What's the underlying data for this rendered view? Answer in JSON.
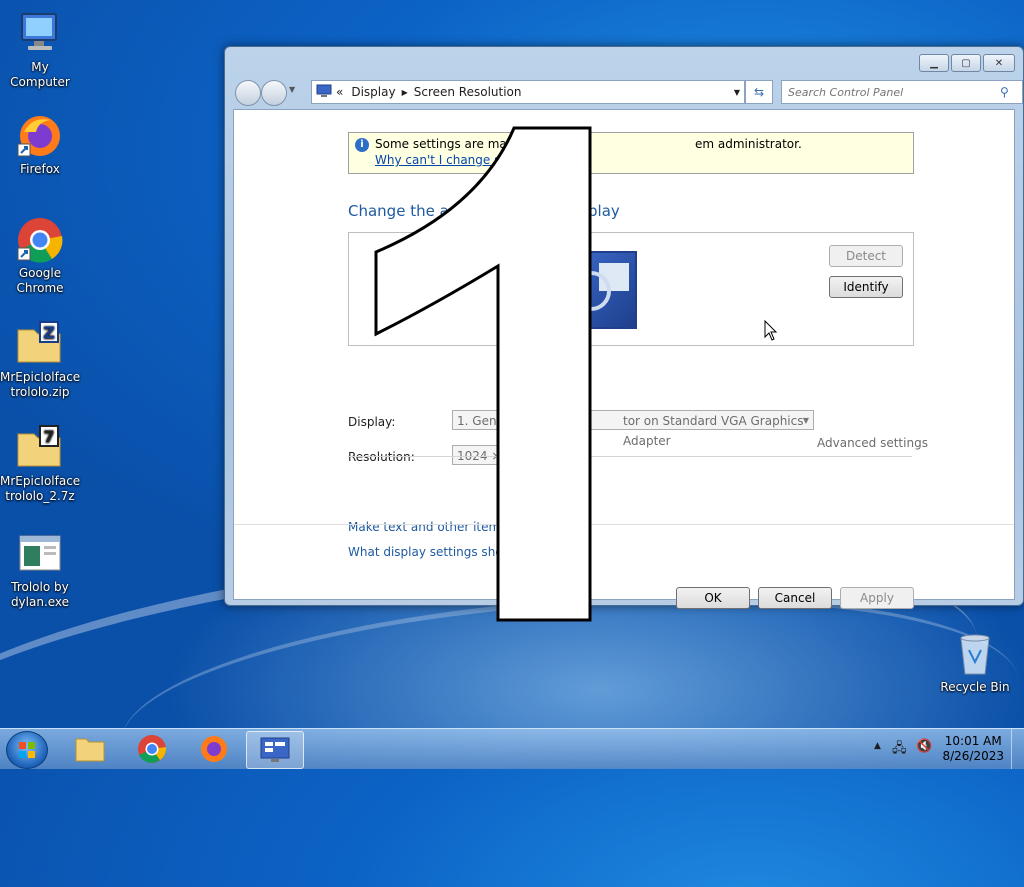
{
  "desktop": {
    "icons": [
      {
        "label": "My Computer"
      },
      {
        "label": "Firefox"
      },
      {
        "label": "Google Chrome"
      },
      {
        "label": "MrEpicIolface trololo.zip"
      },
      {
        "label": "MrEpicIolface trololo_2.7z"
      },
      {
        "label": "Trololo by dylan.exe"
      },
      {
        "label": "Recycle Bin"
      }
    ]
  },
  "window": {
    "breadcrumb": {
      "prefix": "«",
      "items": [
        "Display",
        "Screen Resolution"
      ]
    },
    "search_placeholder": "Search Control Panel",
    "info": {
      "text": "Some settings are manag",
      "text_right": "em administrator.",
      "link": "Why can't I change som"
    },
    "heading_left": "Change the ap",
    "heading_right": "play",
    "buttons": {
      "detect": "Detect",
      "identify": "Identify",
      "ok": "OK",
      "cancel": "Cancel",
      "apply": "Apply"
    },
    "display_label": "Display:",
    "display_value_left": "1. Gener",
    "display_value_right": "tor on Standard VGA Graphics Adapter",
    "resolution_label": "Resolution:",
    "resolution_value": "1024 × 7",
    "advanced": "Advanced settings",
    "link1": "Make text and other items la",
    "link2": "What display settings should"
  },
  "overlay": {
    "digit": "1"
  },
  "taskbar": {
    "time": "10:01 AM",
    "date": "8/26/2023"
  },
  "colors": {
    "accent": "#1e5aa0",
    "infobar": "#ffffe1"
  }
}
